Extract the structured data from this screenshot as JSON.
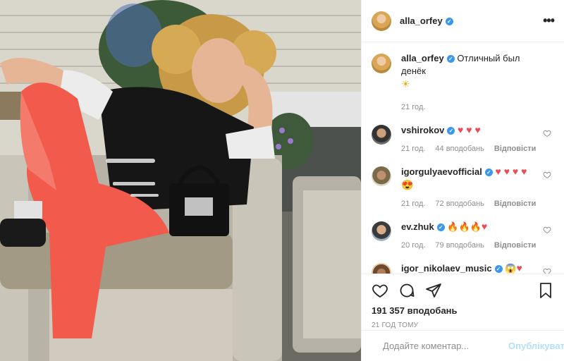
{
  "post": {
    "username": "alla_orfey",
    "caption_text": "Отличный был денёк",
    "caption_emoji": "☀",
    "caption_time": "21 год.",
    "likes": "191 357 вподобань",
    "posted": "21 год тому"
  },
  "comments": [
    {
      "user": "vshirokov",
      "verified": true,
      "text": "",
      "emoji": "♥ ♥ ♥",
      "time": "21 год.",
      "likes": "44 вподобань",
      "reply": "Відповісти"
    },
    {
      "user": "igorgulyaevofficial",
      "verified": true,
      "text": "",
      "emoji": "♥ ♥ ♥ ♥ 😍",
      "time": "21 год.",
      "likes": "72 вподобань",
      "reply": "Відповісти"
    },
    {
      "user": "ev.zhuk",
      "verified": true,
      "text": "",
      "emoji": "🔥🔥🔥",
      "emoji2": "♥",
      "time": "20 год.",
      "likes": "79 вподобань",
      "reply": "Відповісти"
    },
    {
      "user": "igor_nikolaev_music",
      "verified": true,
      "text": "",
      "emoji": "😱",
      "emoji2": "♥",
      "time": "",
      "likes": "",
      "reply": ""
    }
  ],
  "composer": {
    "placeholder": "Додайте коментар...",
    "publish": "Опублікувати"
  },
  "icons": {
    "more": "more-options-icon",
    "like": "heart-icon",
    "comment": "comment-icon",
    "share": "share-icon",
    "save": "bookmark-icon",
    "emoji": "smile-icon"
  },
  "colors": {
    "verified": "#3897f0",
    "heart": "#ed4956",
    "publish_disabled": "#b2dffc"
  }
}
